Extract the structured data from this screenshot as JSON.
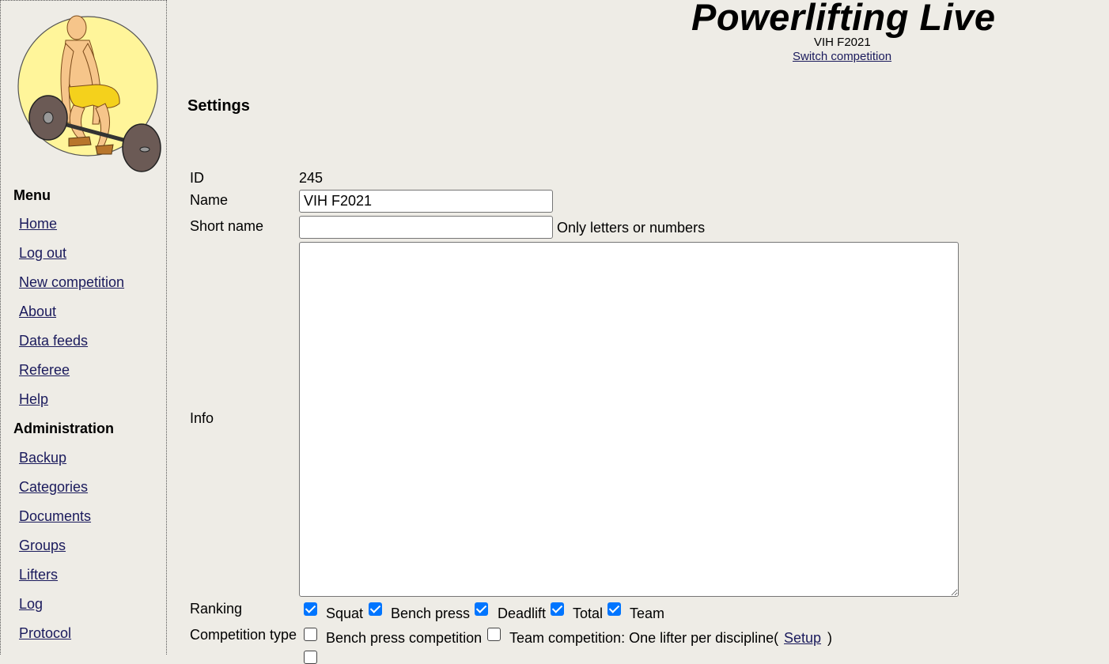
{
  "header": {
    "title": "Powerlifting Live",
    "competition": "VIH F2021",
    "switch_label": "Switch competition"
  },
  "sidebar": {
    "menu_heading": "Menu",
    "menu_items": [
      {
        "label": "Home"
      },
      {
        "label": "Log out"
      },
      {
        "label": "New competition"
      },
      {
        "label": "About"
      },
      {
        "label": "Data feeds"
      },
      {
        "label": "Referee"
      },
      {
        "label": "Help"
      }
    ],
    "admin_heading": "Administration",
    "admin_items": [
      {
        "label": "Backup"
      },
      {
        "label": "Categories"
      },
      {
        "label": "Documents"
      },
      {
        "label": "Groups"
      },
      {
        "label": "Lifters"
      },
      {
        "label": "Log"
      },
      {
        "label": "Protocol"
      }
    ]
  },
  "settings": {
    "title": "Settings",
    "id_label": "ID",
    "id_value": "245",
    "name_label": "Name",
    "name_value": "VIH F2021",
    "short_name_label": "Short name",
    "short_name_value": "",
    "short_name_hint": "Only letters or numbers",
    "info_label": "Info",
    "info_value": "",
    "ranking_label": "Ranking",
    "ranking_options": [
      {
        "label": "Squat",
        "checked": true
      },
      {
        "label": "Bench press",
        "checked": true
      },
      {
        "label": "Deadlift",
        "checked": true
      },
      {
        "label": "Total",
        "checked": true
      },
      {
        "label": "Team",
        "checked": true
      }
    ],
    "competition_type_label": "Competition type",
    "competition_type_options": [
      {
        "label": "Bench press competition",
        "checked": false
      },
      {
        "label": "Team competition: One lifter per discipline(",
        "checked": false
      }
    ],
    "setup_link": "Setup",
    "setup_close": ")"
  },
  "colors": {
    "background": "#eeece6",
    "link": "#1a1a5c",
    "checkbox_checked": "#0075ff",
    "logo_circle": "#fff59a"
  }
}
